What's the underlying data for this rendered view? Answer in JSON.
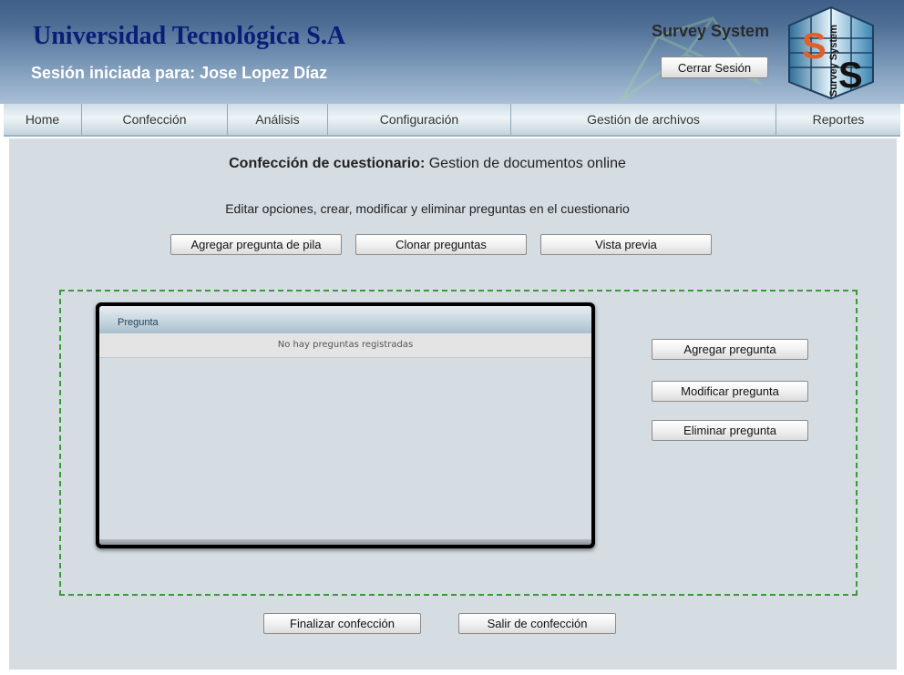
{
  "header": {
    "institution": "Universidad Tecnológica S.A",
    "session_label": "Sesión iniciada para:",
    "user_name": "Jose Lopez Díaz",
    "brand": "Survey System",
    "logout_label": "Cerrar Sesión",
    "logo_text": "Survey System"
  },
  "nav": {
    "items": [
      {
        "label": "Home"
      },
      {
        "label": "Confección"
      },
      {
        "label": "Análisis"
      },
      {
        "label": "Configuración"
      },
      {
        "label": "Gestión de archivos"
      },
      {
        "label": "Reportes"
      }
    ]
  },
  "main": {
    "heading_bold": "Confección de cuestionario:",
    "heading_rest": "Gestion de documentos online",
    "instructions": "Editar opciones, crear, modificar y eliminar preguntas en el cuestionario",
    "top_buttons": {
      "add_from_stack": "Agregar pregunta de pila",
      "clone": "Clonar preguntas",
      "preview": "Vista previa"
    },
    "grid": {
      "column_header": "Pregunta",
      "empty_message": "No hay preguntas registradas"
    },
    "side_buttons": {
      "add": "Agregar pregunta",
      "modify": "Modificar pregunta",
      "delete": "Eliminar pregunta"
    },
    "bottom_buttons": {
      "finish": "Finalizar confección",
      "exit": "Salir de confección"
    }
  }
}
